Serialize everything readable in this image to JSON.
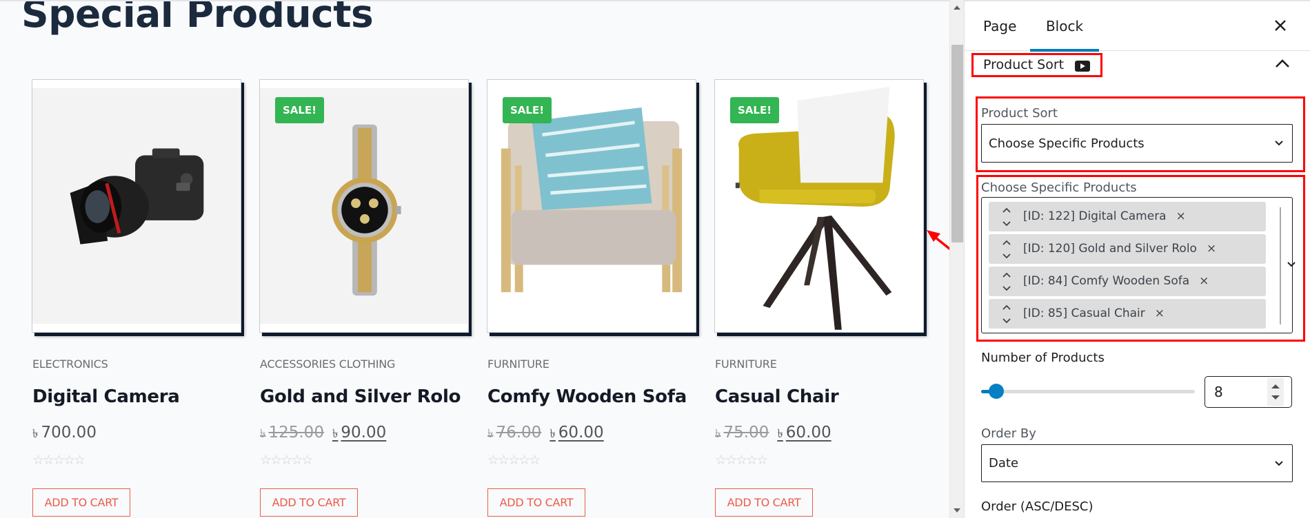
{
  "page": {
    "title": "Special Products"
  },
  "products": [
    {
      "category": "ELECTRONICS",
      "name": "Digital Camera",
      "currency": "৳",
      "old_price": "",
      "price": "700.00",
      "on_sale": false,
      "sale_label": "",
      "rating_stars": 0,
      "rating_glyph": "☆☆☆☆☆",
      "button_label": "ADD TO CART",
      "image": "camera"
    },
    {
      "category": "ACCESSORIES  CLOTHING",
      "name": "Gold and Silver Rolo",
      "currency": "৳",
      "old_price": "125.00",
      "price": "90.00",
      "on_sale": true,
      "sale_label": "SALE!",
      "rating_stars": 0,
      "rating_glyph": "☆☆☆☆☆",
      "button_label": "ADD TO CART",
      "image": "watch"
    },
    {
      "category": "FURNITURE",
      "name": "Comfy Wooden Sofa",
      "currency": "৳",
      "old_price": "76.00",
      "price": "60.00",
      "on_sale": true,
      "sale_label": "SALE!",
      "rating_stars": 0,
      "rating_glyph": "☆☆☆☆☆",
      "button_label": "ADD TO CART",
      "image": "armchair"
    },
    {
      "category": "FURNITURE",
      "name": "Casual Chair",
      "currency": "৳",
      "old_price": "75.00",
      "price": "60.00",
      "on_sale": true,
      "sale_label": "SALE!",
      "rating_stars": 0,
      "rating_glyph": "☆☆☆☆☆",
      "button_label": "ADD TO CART",
      "image": "yellow-chair"
    }
  ],
  "sidebar": {
    "tabs": [
      {
        "label": "Page",
        "active": false
      },
      {
        "label": "Block",
        "active": true
      }
    ],
    "close_icon": "close-icon",
    "panel": {
      "title": "Product Sort",
      "video_icon": "youtube-play-icon",
      "collapse_icon": "chevron-up-icon"
    },
    "product_sort": {
      "label": "Product Sort",
      "value": "Choose Specific Products"
    },
    "specific_products": {
      "label": "Choose Specific Products",
      "items": [
        {
          "label": "[ID: 122] Digital Camera",
          "remove": "×"
        },
        {
          "label": "[ID: 120] Gold and Silver Rolo",
          "remove": "×"
        },
        {
          "label": "[ID: 84] Comfy Wooden Sofa",
          "remove": "×"
        },
        {
          "label": "[ID: 85] Casual Chair",
          "remove": "×"
        }
      ]
    },
    "number_of_products": {
      "label": "Number of Products",
      "value": "8",
      "slider_fraction": 0.07
    },
    "order_by": {
      "label": "Order By",
      "value": "Date"
    },
    "order": {
      "label": "Order (ASC/DESC)"
    }
  },
  "colors": {
    "accent": "#007cba",
    "sale_badge": "#32b552",
    "cart_button": "#ec5b4a",
    "annotation": "#ff0000",
    "title": "#1b2a3d"
  }
}
